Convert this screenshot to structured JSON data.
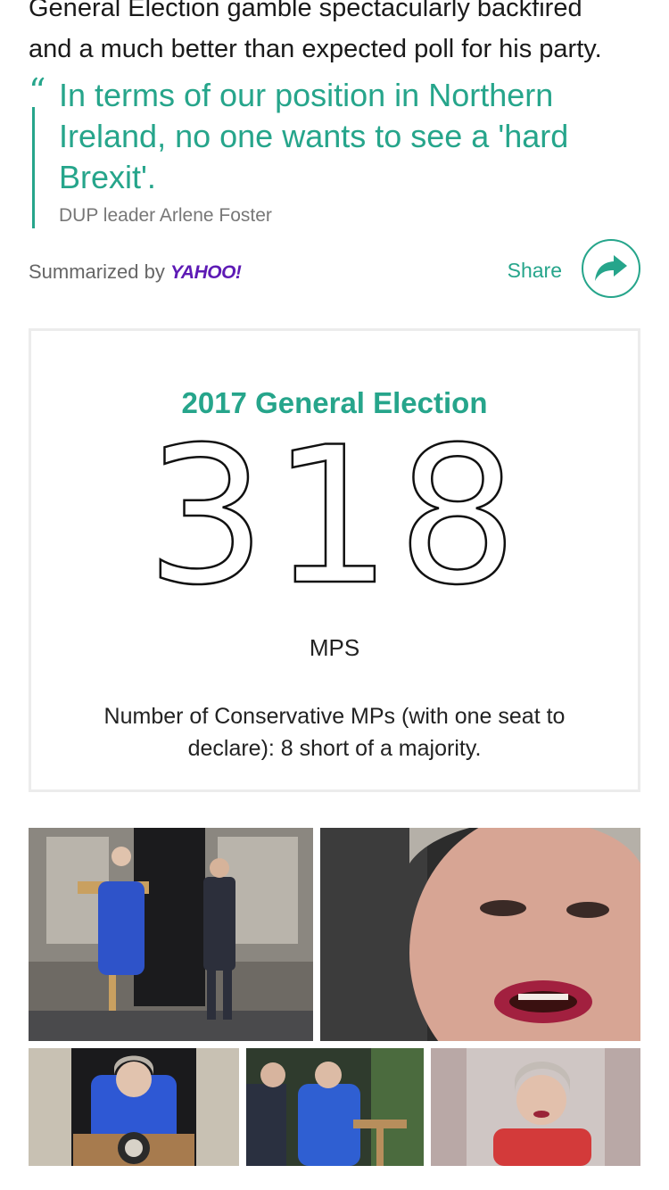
{
  "article": {
    "line1": "General Election gamble spectacularly backfired",
    "line2": "and a much better than expected poll for his party."
  },
  "quote": {
    "mark": "“",
    "text": "In terms of our position in Northern Ireland, no one wants to see a 'hard Brexit'.",
    "attribution": "DUP leader Arlene Foster"
  },
  "summary": {
    "label": "Summarized by",
    "brand": "YAHOO!",
    "share_label": "Share",
    "share_icon": "share-arrow-icon"
  },
  "stat_card": {
    "title": "2017 General Election",
    "value": "318",
    "unit": "MPS",
    "caption": "Number of Conservative MPs (with one seat to declare): 8 short of a majority."
  },
  "gallery": {
    "photos": [
      {
        "subject": "podium-photo-downing-street"
      },
      {
        "subject": "closeup-face-photo"
      },
      {
        "subject": "podium-speech-photo"
      },
      {
        "subject": "walking-couple-photo"
      },
      {
        "subject": "red-jacket-photo"
      }
    ]
  },
  "colors": {
    "accent": "#26a58b",
    "brand_purple": "#5d1ab5",
    "muted_text": "#777777"
  }
}
